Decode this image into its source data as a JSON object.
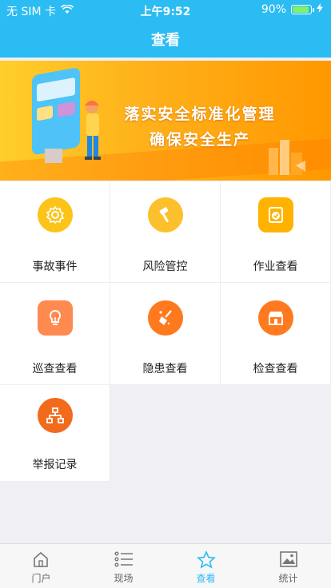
{
  "status_bar": {
    "carrier": "无 SIM 卡",
    "time": "上午9:52",
    "battery": "90%",
    "battery_level": 0.9
  },
  "header": {
    "title": "查看"
  },
  "banner": {
    "line1": "落实安全标准化管理",
    "line2": "确保安全生产"
  },
  "grid": {
    "items": [
      {
        "label": "事故事件",
        "icon": "gear-icon",
        "color": "#fcc419"
      },
      {
        "label": "风险管控",
        "icon": "hammer-icon",
        "color": "#fcc02c"
      },
      {
        "label": "作业查看",
        "icon": "clipboard-check-icon",
        "color": "#ffb300"
      },
      {
        "label": "巡查查看",
        "icon": "lightbulb-icon",
        "color": "#ff8a50"
      },
      {
        "label": "隐患查看",
        "icon": "broom-icon",
        "color": "#ff7a1f"
      },
      {
        "label": "检查查看",
        "icon": "store-icon",
        "color": "#ff7a1f"
      },
      {
        "label": "举报记录",
        "icon": "org-chart-icon",
        "color": "#f26a1b"
      }
    ]
  },
  "tabbar": {
    "tabs": [
      {
        "label": "门户",
        "icon": "home-icon"
      },
      {
        "label": "现场",
        "icon": "list-icon"
      },
      {
        "label": "查看",
        "icon": "star-icon",
        "active": true
      },
      {
        "label": "统计",
        "icon": "image-icon"
      }
    ]
  },
  "colors": {
    "accent": "#2bbcf3",
    "banner": "#ffb01a"
  }
}
